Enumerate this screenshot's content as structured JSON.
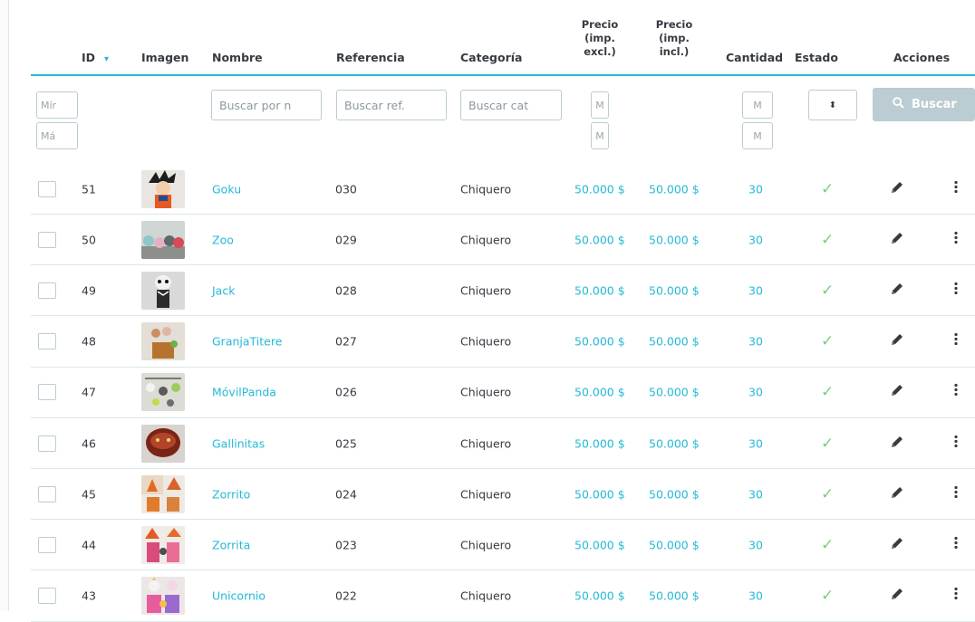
{
  "columns": {
    "id": "ID",
    "image": "Imagen",
    "name": "Nombre",
    "reference": "Referencia",
    "category": "Categoría",
    "price_excl": [
      "Precio",
      "(imp.",
      "excl.)"
    ],
    "price_incl": [
      "Precio",
      "(imp.",
      "incl.)"
    ],
    "quantity": "Cantidad",
    "status": "Estado",
    "actions": "Acciones"
  },
  "filters": {
    "id_min_placeholder": "Mír",
    "id_max_placeholder": "Má",
    "name_placeholder": "Buscar por n",
    "reference_placeholder": "Buscar ref.",
    "category_placeholder": "Buscar cat",
    "price_min_placeholder": "M",
    "price_max_placeholder": "M",
    "qty_min_placeholder": "M",
    "qty_max_placeholder": "M",
    "status_select_icon": "⬍",
    "search_button": "Buscar",
    "search_icon": "search-icon"
  },
  "icons": {
    "sort": "chevron-down-icon",
    "status_check": "✓",
    "edit": "pencil-icon",
    "more": "more-vertical-icon"
  },
  "colors": {
    "accent": "#25b9d7",
    "check": "#78d07d",
    "button_disabled": "#bbcdd2",
    "text": "#363a41"
  },
  "products": [
    {
      "id": "51",
      "name": "Goku",
      "reference": "030",
      "category": "Chiquero",
      "price_excl": "50.000 $",
      "price_incl": "50.000 $",
      "quantity": "30"
    },
    {
      "id": "50",
      "name": "Zoo",
      "reference": "029",
      "category": "Chiquero",
      "price_excl": "50.000 $",
      "price_incl": "50.000 $",
      "quantity": "30"
    },
    {
      "id": "49",
      "name": "Jack",
      "reference": "028",
      "category": "Chiquero",
      "price_excl": "50.000 $",
      "price_incl": "50.000 $",
      "quantity": "30"
    },
    {
      "id": "48",
      "name": "GranjaTitere",
      "reference": "027",
      "category": "Chiquero",
      "price_excl": "50.000 $",
      "price_incl": "50.000 $",
      "quantity": "30"
    },
    {
      "id": "47",
      "name": "MóvilPanda",
      "reference": "026",
      "category": "Chiquero",
      "price_excl": "50.000 $",
      "price_incl": "50.000 $",
      "quantity": "30"
    },
    {
      "id": "46",
      "name": "Gallinitas",
      "reference": "025",
      "category": "Chiquero",
      "price_excl": "50.000 $",
      "price_incl": "50.000 $",
      "quantity": "30"
    },
    {
      "id": "45",
      "name": "Zorrito",
      "reference": "024",
      "category": "Chiquero",
      "price_excl": "50.000 $",
      "price_incl": "50.000 $",
      "quantity": "30"
    },
    {
      "id": "44",
      "name": "Zorrita",
      "reference": "023",
      "category": "Chiquero",
      "price_excl": "50.000 $",
      "price_incl": "50.000 $",
      "quantity": "30"
    },
    {
      "id": "43",
      "name": "Unicornio",
      "reference": "022",
      "category": "Chiquero",
      "price_excl": "50.000 $",
      "price_incl": "50.000 $",
      "quantity": "30"
    }
  ]
}
